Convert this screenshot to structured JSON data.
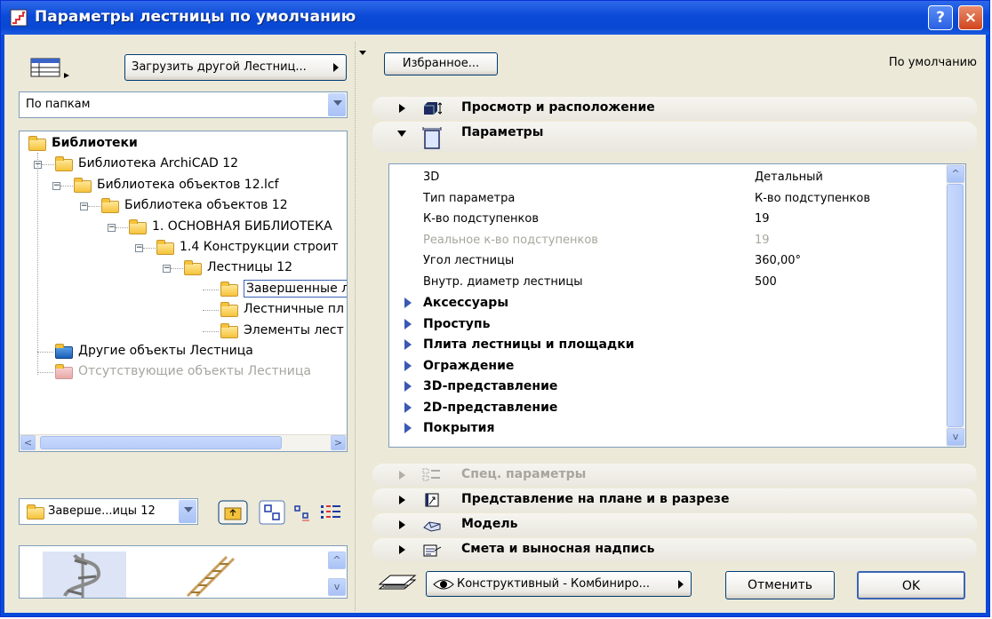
{
  "window": {
    "title": "Параметры лестницы по умолчанию",
    "help_label": "?",
    "close_label": "×"
  },
  "left": {
    "load_button": "Загрузить другой Лестниц...",
    "view_select": "По папкам",
    "tree": [
      {
        "label": "Библиотеки",
        "level": 0,
        "bold": true
      },
      {
        "label": "Библиотека ArchiCAD 12",
        "level": 1
      },
      {
        "label": "Библиотека объектов 12.lcf",
        "level": 2
      },
      {
        "label": "Библиотека объектов 12",
        "level": 3
      },
      {
        "label": "1. ОСНОВНАЯ БИБЛИОТЕКА",
        "level": 4
      },
      {
        "label": "1.4 Конструкции строит",
        "level": 5
      },
      {
        "label": "Лестницы 12",
        "level": 6
      },
      {
        "label": "Завершенные л",
        "level": 7,
        "selected": true
      },
      {
        "label": "Лестничные пл",
        "level": 7
      },
      {
        "label": "Элементы лест",
        "level": 7
      },
      {
        "label": "Другие объекты Лестница",
        "level": 1,
        "special": "blue"
      },
      {
        "label": "Отсутствующие объекты Лестница",
        "level": 1,
        "special": "missing"
      }
    ],
    "folder_select": "Заверше...ицы 12",
    "scroll_left": "<",
    "scroll_right": ">",
    "scroll_up": "^",
    "scroll_down": "v"
  },
  "right": {
    "favorites_button": "Избранное...",
    "defaults_label": "По умолчанию",
    "sections_top": [
      {
        "label": "Просмотр и расположение",
        "open": false
      },
      {
        "label": "Параметры",
        "open": true
      }
    ],
    "params": [
      {
        "name": "3D",
        "value": "Детальный"
      },
      {
        "name": "Тип параметра",
        "value": "К-во подступенков"
      },
      {
        "name": "К-во подступенков",
        "value": "19"
      },
      {
        "name": "Реальное к-во подступенков",
        "value": "19",
        "disabled": true
      },
      {
        "name": "Угол лестницы",
        "value": "360,00°"
      },
      {
        "name": "Внутр. диаметр лестницы",
        "value": "500"
      },
      {
        "name": "Аксессуары",
        "group": true
      },
      {
        "name": "Проступь",
        "group": true
      },
      {
        "name": "Плита лестницы и площадки",
        "group": true
      },
      {
        "name": "Ограждение",
        "group": true
      },
      {
        "name": "3D-представление",
        "group": true
      },
      {
        "name": "2D-представление",
        "group": true
      },
      {
        "name": "Покрытия",
        "group": true
      }
    ],
    "sections_bottom": [
      {
        "label": "Спец. параметры",
        "disabled": true
      },
      {
        "label": "Представление на плане и в разрезе"
      },
      {
        "label": "Модель"
      },
      {
        "label": "Смета и выносная надпись"
      }
    ],
    "layer_select": "Конструктивный - Комбиниро...",
    "cancel_button": "Отменить",
    "ok_button": "OK"
  },
  "colors": {
    "title_bar": "#0a4ad8",
    "dialog_bg": "#ece9d8",
    "folder": "#f5c33b",
    "group_triangle": "#3b58b4"
  }
}
